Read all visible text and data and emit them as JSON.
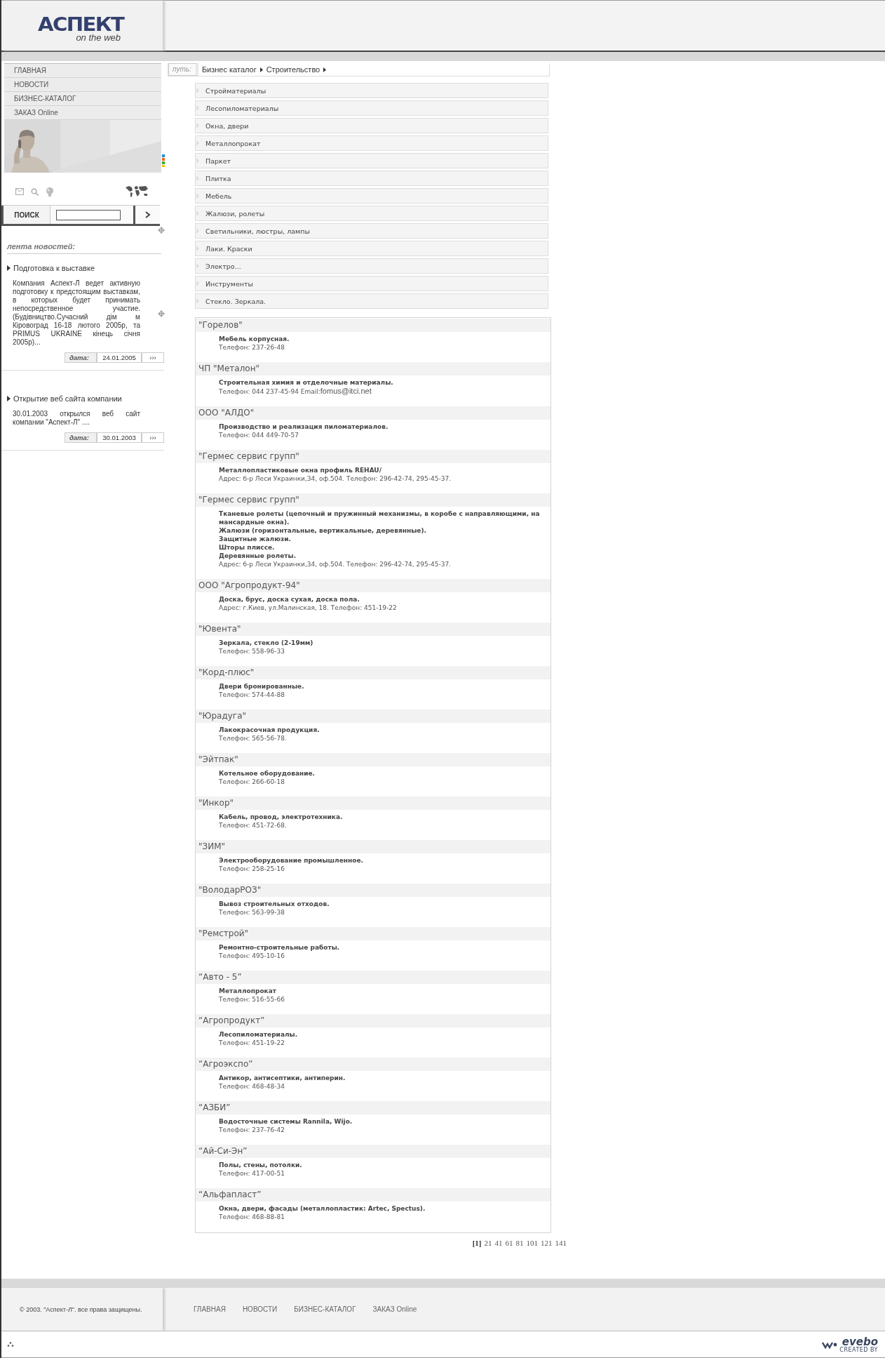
{
  "logo": {
    "title": "АСПЕКТ",
    "tagline": "on the web"
  },
  "nav": [
    {
      "label": "ГЛАВНАЯ"
    },
    {
      "label": "НОВОСТИ"
    },
    {
      "label": "БИЗНЕС-КАТАЛОГ"
    },
    {
      "label": "ЗАКАЗ Online"
    }
  ],
  "search": {
    "button": "ПОИСК"
  },
  "news": {
    "heading": "лента новостей:",
    "items": [
      {
        "title": "Подготовка к выставке",
        "text": "Компания Аспект-Л ведет активную подготовку к предстоящим выставкам, в которых будет принимать непосредственное участие.(Будівництво.Сучасний дім м Кіровоград 16-18 лютого 2005р, та PRIMUS UKRAINE кінець січня 2005р)...",
        "date_label": "дата:",
        "date": "24.01.2005",
        "more": "›››"
      },
      {
        "title": "Открытие веб сайта компании",
        "text": "30.01.2003 открылся веб сайт компании \"Аспект-Л\" ....",
        "date_label": "дата:",
        "date": "30.01.2003",
        "more": "›››"
      }
    ]
  },
  "breadcrumb": {
    "label": "путь:",
    "items": [
      "Бизнес каталог",
      "Строительство"
    ]
  },
  "categories": [
    "Стройматериалы",
    "Лесопиломатериалы",
    "Окна, двери",
    "Металлопрокат",
    "Паркет",
    "Плитка",
    "Мебель",
    "Жалюзи, ролеты",
    "Светильники, люстры, лампы",
    "Лаки. Краски",
    "Электро...",
    "Инструменты",
    "Стекло. Зеркала."
  ],
  "listings": [
    {
      "name": "\"Горелов\"",
      "description": [
        "Мебель корпусная."
      ],
      "contact": "Телефон: 237-26-48"
    },
    {
      "name": "ЧП \"Металон\"",
      "description": [
        "Строительная химия и отделочные материалы."
      ],
      "contact": "Телефон: 044 237-45-94 Email:",
      "email": "fomus@itci.net"
    },
    {
      "name": "ООО \"АЛДО\"",
      "description": [
        "Производство и реализация пиломатериалов."
      ],
      "contact": "Телефон: 044 449-70-57"
    },
    {
      "name": "\"Гермес сервис групп\"",
      "description": [
        "Металлопластиковые окна профиль REHAU/"
      ],
      "contact": "Адрес: б-р Леси Украинки,34, оф.504. Телефон: 296-42-74, 295-45-37."
    },
    {
      "name": "\"Гермес сервис групп\"",
      "description": [
        "Тканевые ролеты (цепочный и пружинный механизмы, в коробе с направляющими, на мансардные окна).",
        "Жалюзи (горизонтальные, вертикальные, деревянные).",
        "Защитные жалюзи.",
        "Шторы плиссе.",
        "Деревянные ролеты."
      ],
      "contact": "Адрес: б-р Леси Украинки,34, оф.504. Телефон: 296-42-74, 295-45-37."
    },
    {
      "name": "ООО \"Агропродукт-94\"",
      "description": [
        "Доска, брус, доска сухая, доска пола."
      ],
      "contact": "Адрес: г.Киев, ул.Малинская, 18. Телефон: 451-19-22"
    },
    {
      "name": "\"Ювента\"",
      "description": [
        "Зеркала, стекло (2-19мм)"
      ],
      "contact": "Телефон: 558-96-33"
    },
    {
      "name": "\"Корд-плюс\"",
      "description": [
        "Двери бронированные."
      ],
      "contact": "Телефон: 574-44-88"
    },
    {
      "name": "\"Юрадуга\"",
      "description": [
        "Лакокрасочная продукция."
      ],
      "contact": "Телефон: 565-56-78."
    },
    {
      "name": "\"Эйтпак\"",
      "description": [
        "Котельное оборудование."
      ],
      "contact": "Телефон: 266-60-18"
    },
    {
      "name": "\"Инкор\"",
      "description": [
        "Кабель, провод, электротехника."
      ],
      "contact": "Телефон: 451-72-68."
    },
    {
      "name": "\"ЗИМ\"",
      "description": [
        "Электрооборудование промышленное."
      ],
      "contact": "Телефон: 258-25-16"
    },
    {
      "name": "\"ВолодарРОЗ\"",
      "description": [
        "Вывоз строительных отходов."
      ],
      "contact": "Телефон: 563-99-38"
    },
    {
      "name": "\"Ремстрой\"",
      "description": [
        "Ремонтно-строительные работы."
      ],
      "contact": "Телефон: 495-10-16"
    },
    {
      "name": "“Авто - 5”",
      "description": [
        "Металлопрокат"
      ],
      "contact": "Телефон: 516-55-66"
    },
    {
      "name": "“Агропродукт”",
      "description": [
        "Лесопиломатериалы."
      ],
      "contact": "Телефон: 451-19-22"
    },
    {
      "name": "“Агроэкспо”",
      "description": [
        "Антикор, антисептики, антиперин."
      ],
      "contact": "Телефон: 468-48-34"
    },
    {
      "name": "“АЗБИ”",
      "description": [
        "Водосточные системы Rannila, Wijo."
      ],
      "contact": "Телефон: 237-76-42"
    },
    {
      "name": "“Ай-Си-Эн”",
      "description": [
        "Полы, стены, потолки."
      ],
      "contact": "Телефон: 417-00-51"
    },
    {
      "name": "“Альфапласт”",
      "description": [
        "Окна, двери, фасады (металлопластик: Artec, Spectus)."
      ],
      "contact": "Телефон: 468-88-81"
    }
  ],
  "pagination": [
    {
      "label": "[1]",
      "selected": true
    },
    {
      "label": "21",
      "selected": false
    },
    {
      "label": "41",
      "selected": false
    },
    {
      "label": "61",
      "selected": false
    },
    {
      "label": "81",
      "selected": false
    },
    {
      "label": "101",
      "selected": false
    },
    {
      "label": "121",
      "selected": false
    },
    {
      "label": "141",
      "selected": false
    }
  ],
  "footer": {
    "copyright": "© 2003. \"Аспект-Л\". все права защищены.",
    "links": [
      "ГЛАВНАЯ",
      "НОВОСТИ",
      "БИЗНЕС-КАТАЛОГ",
      "ЗАКАЗ Online"
    ],
    "credit": {
      "logo": "evebo",
      "caption": "CREATED BY"
    }
  }
}
